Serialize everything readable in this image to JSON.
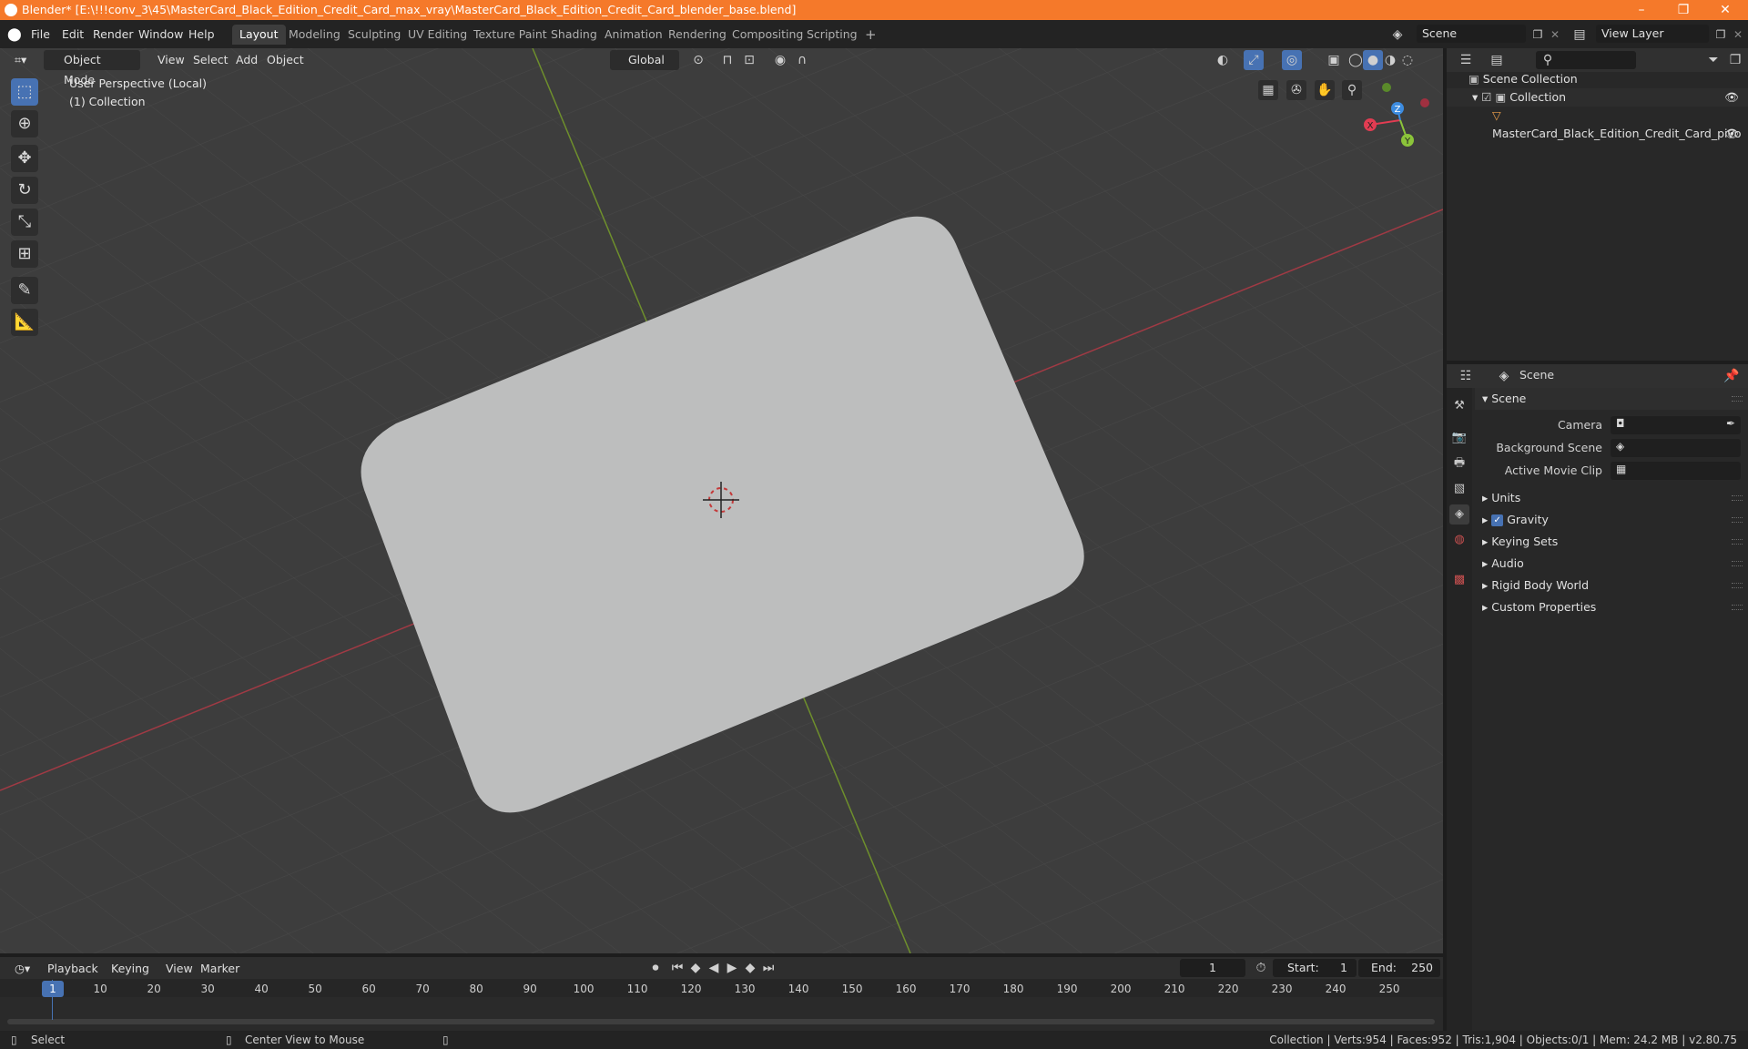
{
  "window": {
    "title": "Blender* [E:\\!!!conv_3\\45\\MasterCard_Black_Edition_Credit_Card_max_vray\\MasterCard_Black_Edition_Credit_Card_blender_base.blend]",
    "minimize": "–",
    "maximize": "❐",
    "close": "✕"
  },
  "menu": [
    "File",
    "Edit",
    "Render",
    "Window",
    "Help"
  ],
  "workspaces": [
    "Layout",
    "Modeling",
    "Sculpting",
    "UV Editing",
    "Texture Paint",
    "Shading",
    "Animation",
    "Rendering",
    "Compositing",
    "Scripting"
  ],
  "active_workspace": "Layout",
  "add_workspace": "+",
  "scene_field": "Scene",
  "view_layer_field": "View Layer",
  "viewport": {
    "mode": "Object Mode",
    "menus": [
      "View",
      "Select",
      "Add",
      "Object"
    ],
    "orientation": "Global",
    "info_line1": "User Perspective (Local)",
    "info_line2": "(1) Collection",
    "gizmo": {
      "x": "X",
      "y": "Y",
      "z": "Z"
    }
  },
  "outliner": {
    "root": "Scene Collection",
    "collection": "Collection",
    "object": "MasterCard_Black_Edition_Credit_Card_pivo"
  },
  "properties": {
    "header": "Scene",
    "panel_title": "Scene",
    "camera_label": "Camera",
    "background_scene_label": "Background Scene",
    "active_movie_clip_label": "Active Movie Clip",
    "sections": [
      "Units",
      "Gravity",
      "Keying Sets",
      "Audio",
      "Rigid Body World",
      "Custom Properties"
    ],
    "gravity_checked": true
  },
  "timeline": {
    "menus": [
      "Playback",
      "Keying",
      "View",
      "Marker"
    ],
    "current_frame": "1",
    "start_label": "Start:",
    "start_value": "1",
    "end_label": "End:",
    "end_value": "250",
    "ticks": [
      "1",
      "10",
      "20",
      "30",
      "40",
      "50",
      "60",
      "70",
      "80",
      "90",
      "100",
      "110",
      "120",
      "130",
      "140",
      "150",
      "160",
      "170",
      "180",
      "190",
      "200",
      "210",
      "220",
      "230",
      "240",
      "250"
    ]
  },
  "statusbar": {
    "select": "Select",
    "center_view": "Center View to Mouse",
    "stats": "Collection | Verts:954 | Faces:952 | Tris:1,904 | Objects:0/1 | Mem: 24.2 MB | v2.80.75"
  },
  "colors": {
    "title_bar": "#f5792a",
    "accent_blue": "#4772b3",
    "axis_x": "#e23c52",
    "axis_y": "#8bc43a",
    "axis_z": "#3d8ce0"
  }
}
